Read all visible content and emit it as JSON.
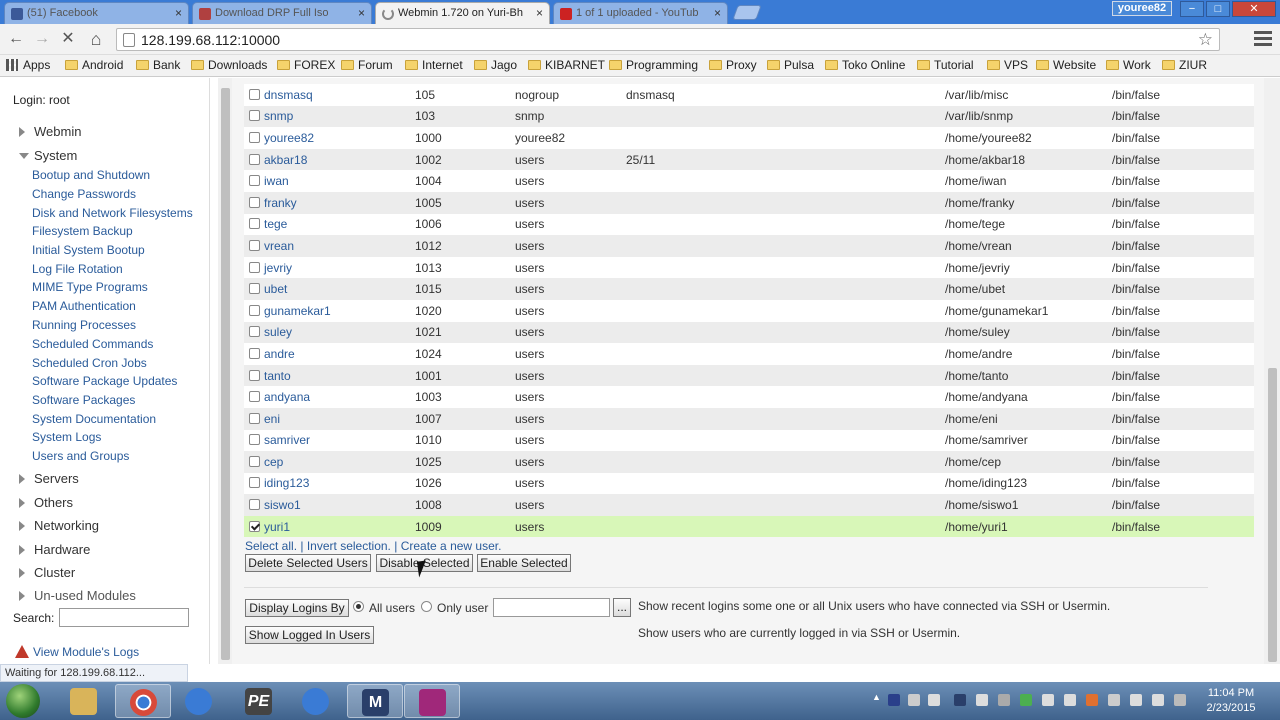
{
  "browser": {
    "tabs": [
      {
        "label": "(51) Facebook",
        "active": false,
        "favicon_color": "#3b5998"
      },
      {
        "label": "Download DRP Full Iso",
        "active": false,
        "favicon_color": "#b04040"
      },
      {
        "label": "Webmin 1.720 on Yuri-Bh",
        "active": true,
        "favicon_color": "#888888"
      },
      {
        "label": "1 of 1 uploaded - YouTub",
        "active": false,
        "favicon_color": "#cc2222"
      }
    ],
    "tab_close_glyph": "×",
    "window_user": "youree82",
    "window_buttons": [
      "−",
      "□",
      "✕"
    ],
    "nav": {
      "back": "←",
      "forward": "→",
      "stop": "✕",
      "home": "⌂"
    },
    "url": "128.199.68.112:10000",
    "star": "☆",
    "bookmarks": [
      "Apps",
      "Android",
      "Bank",
      "Downloads",
      "FOREX",
      "Forum",
      "Internet",
      "Jago",
      "KIBARNET",
      "Programming",
      "Proxy",
      "Pulsa",
      "Toko Online",
      "Tutorial",
      "VPS",
      "Website",
      "Work",
      "ZIUR"
    ]
  },
  "sidebar": {
    "login": "Login: root",
    "categories_top": [
      {
        "label": "Webmin",
        "open": false
      },
      {
        "label": "System",
        "open": true
      }
    ],
    "system_modules": [
      "Bootup and Shutdown",
      "Change Passwords",
      "Disk and Network Filesystems",
      "Filesystem Backup",
      "Initial System Bootup",
      "Log File Rotation",
      "MIME Type Programs",
      "PAM Authentication",
      "Running Processes",
      "Scheduled Commands",
      "Scheduled Cron Jobs",
      "Software Package Updates",
      "Software Packages",
      "System Documentation",
      "System Logs",
      "Users and Groups"
    ],
    "categories_bottom": [
      "Servers",
      "Others",
      "Networking",
      "Hardware",
      "Cluster",
      "Un-used Modules"
    ],
    "search_label": "Search:",
    "view_logs": "View Module's Logs"
  },
  "users": [
    {
      "name": "dnsmasq",
      "uid": "105",
      "group": "nogroup",
      "real": "dnsmasq",
      "home": "/var/lib/misc",
      "shell": "/bin/false",
      "checked": false
    },
    {
      "name": "snmp",
      "uid": "103",
      "group": "snmp",
      "real": "",
      "home": "/var/lib/snmp",
      "shell": "/bin/false",
      "checked": false
    },
    {
      "name": "youree82",
      "uid": "1000",
      "group": "youree82",
      "real": "",
      "home": "/home/youree82",
      "shell": "/bin/false",
      "checked": false
    },
    {
      "name": "akbar18",
      "uid": "1002",
      "group": "users",
      "real": "25/11",
      "home": "/home/akbar18",
      "shell": "/bin/false",
      "checked": false
    },
    {
      "name": "iwan",
      "uid": "1004",
      "group": "users",
      "real": "",
      "home": "/home/iwan",
      "shell": "/bin/false",
      "checked": false
    },
    {
      "name": "franky",
      "uid": "1005",
      "group": "users",
      "real": "",
      "home": "/home/franky",
      "shell": "/bin/false",
      "checked": false
    },
    {
      "name": "tege",
      "uid": "1006",
      "group": "users",
      "real": "",
      "home": "/home/tege",
      "shell": "/bin/false",
      "checked": false
    },
    {
      "name": "vrean",
      "uid": "1012",
      "group": "users",
      "real": "",
      "home": "/home/vrean",
      "shell": "/bin/false",
      "checked": false
    },
    {
      "name": "jevriy",
      "uid": "1013",
      "group": "users",
      "real": "",
      "home": "/home/jevriy",
      "shell": "/bin/false",
      "checked": false
    },
    {
      "name": "ubet",
      "uid": "1015",
      "group": "users",
      "real": "",
      "home": "/home/ubet",
      "shell": "/bin/false",
      "checked": false
    },
    {
      "name": "gunamekar1",
      "uid": "1020",
      "group": "users",
      "real": "",
      "home": "/home/gunamekar1",
      "shell": "/bin/false",
      "checked": false
    },
    {
      "name": "suley",
      "uid": "1021",
      "group": "users",
      "real": "",
      "home": "/home/suley",
      "shell": "/bin/false",
      "checked": false
    },
    {
      "name": "andre",
      "uid": "1024",
      "group": "users",
      "real": "",
      "home": "/home/andre",
      "shell": "/bin/false",
      "checked": false
    },
    {
      "name": "tanto",
      "uid": "1001",
      "group": "users",
      "real": "",
      "home": "/home/tanto",
      "shell": "/bin/false",
      "checked": false
    },
    {
      "name": "andyana",
      "uid": "1003",
      "group": "users",
      "real": "",
      "home": "/home/andyana",
      "shell": "/bin/false",
      "checked": false
    },
    {
      "name": "eni",
      "uid": "1007",
      "group": "users",
      "real": "",
      "home": "/home/eni",
      "shell": "/bin/false",
      "checked": false
    },
    {
      "name": "samriver",
      "uid": "1010",
      "group": "users",
      "real": "",
      "home": "/home/samriver",
      "shell": "/bin/false",
      "checked": false
    },
    {
      "name": "cep",
      "uid": "1025",
      "group": "users",
      "real": "",
      "home": "/home/cep",
      "shell": "/bin/false",
      "checked": false
    },
    {
      "name": "iding123",
      "uid": "1026",
      "group": "users",
      "real": "",
      "home": "/home/iding123",
      "shell": "/bin/false",
      "checked": false
    },
    {
      "name": "siswo1",
      "uid": "1008",
      "group": "users",
      "real": "",
      "home": "/home/siswo1",
      "shell": "/bin/false",
      "checked": false
    },
    {
      "name": "yuri1",
      "uid": "1009",
      "group": "users",
      "real": "",
      "home": "/home/yuri1",
      "shell": "/bin/false",
      "checked": true
    }
  ],
  "actions": {
    "select_all": "Select all.",
    "invert_selection": "Invert selection.",
    "create_user": "Create a new user.",
    "separator": "|",
    "delete_selected": "Delete Selected Users",
    "disable_selected": "Disable Selected",
    "enable_selected": "Enable Selected"
  },
  "logins": {
    "display_logins_by": "Display Logins By",
    "all_users": "All users",
    "only_user": "Only user",
    "chooser": "...",
    "recent_desc": "Show recent logins some one or all Unix users who have connected via SSH or Usermin.",
    "show_logged_in": "Show Logged In Users",
    "logged_in_desc": "Show users who are currently logged in via SSH or Usermin."
  },
  "status_text": "Waiting for 128.199.68.112...",
  "taskbar": {
    "apps": [
      {
        "name": "explorer",
        "color": "#d9b45a",
        "glyph": ""
      },
      {
        "name": "chrome",
        "color": "#d84a3a",
        "glyph": "",
        "active": true
      },
      {
        "name": "app-blue-1",
        "color": "#3a7bd5",
        "glyph": ""
      },
      {
        "name": "pe-peid",
        "color": "#444444",
        "glyph": "PE"
      },
      {
        "name": "app-blue-2",
        "color": "#3a7bd5",
        "glyph": ""
      },
      {
        "name": "m-app",
        "color": "#2a3f6a",
        "glyph": "M",
        "active": true
      },
      {
        "name": "recorder",
        "color": "#a0287a",
        "glyph": "",
        "active": true
      }
    ],
    "tray_up_arrow": "▲",
    "clock_time": "11:04 PM",
    "clock_date": "2/23/2015"
  },
  "colors": {
    "selected_row": "#d8f7b8",
    "link": "#2a5b9a",
    "tabbar": "#3a7bd5"
  }
}
